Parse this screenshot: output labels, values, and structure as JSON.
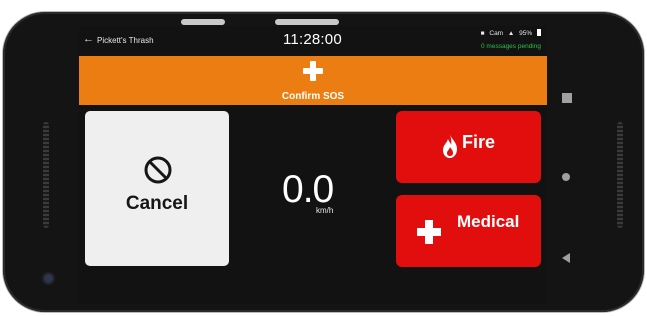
{
  "status_bar": {
    "back_icon": "arrow-left-icon",
    "route_name": "Pickett's Thrash",
    "clock": "11:28:00",
    "car_label": "Cam",
    "battery": "95%",
    "pending_messages": "0 messages pending"
  },
  "sos": {
    "icon": "plus-icon",
    "label": "Confirm SOS",
    "color": "#ec7d12"
  },
  "cancel": {
    "icon": "prohibited-icon",
    "label": "Cancel"
  },
  "speed": {
    "value": "0.0",
    "unit": "km/h"
  },
  "fire": {
    "icon": "flame-icon",
    "label": "Fire",
    "color": "#e20e0e"
  },
  "medical": {
    "icon": "plus-icon",
    "label": "Medical",
    "color": "#e20e0e"
  },
  "nav": {
    "recents_icon": "square-icon",
    "home_icon": "circle-icon",
    "back_icon": "triangle-back-icon"
  }
}
